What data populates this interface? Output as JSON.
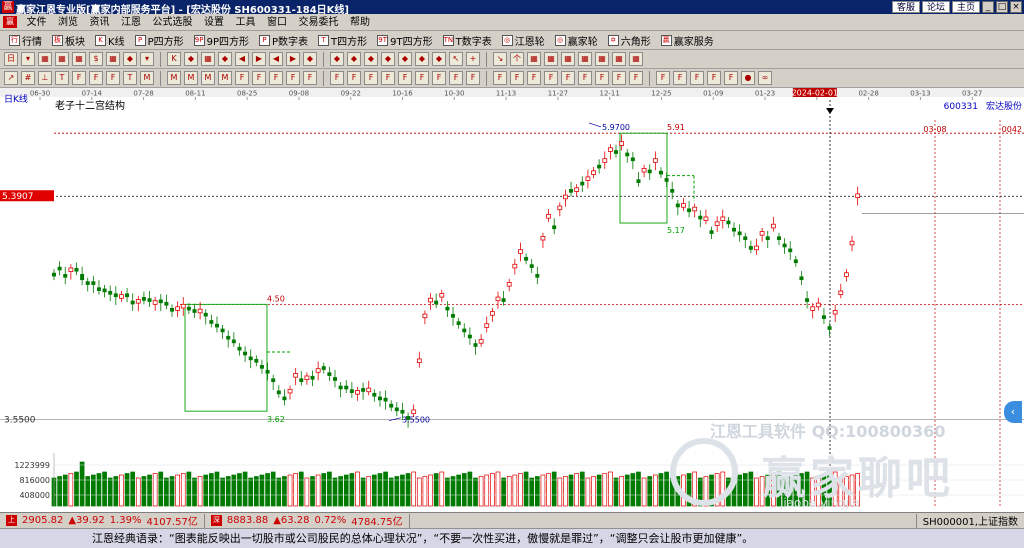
{
  "titlebar": {
    "app_icon": "赢",
    "title": "赢家江恩专业版[赢家内部服务平台] - [宏达股份  SH600331-184日K线]",
    "links": [
      "客服",
      "论坛",
      "主页"
    ],
    "win_buttons": [
      "_",
      "□",
      "×"
    ]
  },
  "menubar": {
    "logo": "赢",
    "items": [
      "文件",
      "浏览",
      "资讯",
      "江恩",
      "公式选股",
      "设置",
      "工具",
      "窗口",
      "交易委托",
      "帮助"
    ]
  },
  "toolbar1": [
    {
      "icon": "行",
      "label": "行情"
    },
    {
      "icon": "板",
      "label": "板块"
    },
    {
      "icon": "K",
      "label": "K线"
    },
    {
      "icon": "P",
      "label": "P四方形"
    },
    {
      "icon": "9P",
      "label": "9P四方形"
    },
    {
      "icon": "P",
      "label": "P数字表"
    },
    {
      "icon": "T",
      "label": "T四方形"
    },
    {
      "icon": "9T",
      "label": "9T四方形"
    },
    {
      "icon": "TN",
      "label": "T数字表"
    },
    {
      "icon": "◎",
      "label": "江恩轮"
    },
    {
      "icon": "◎",
      "label": "赢家轮"
    },
    {
      "icon": "✡",
      "label": "六角形"
    },
    {
      "icon": "赢",
      "label": "赢家服务"
    }
  ],
  "toolbar2_icons": [
    "日",
    "▾",
    "▦",
    "▦",
    "▦",
    "$",
    "▦",
    "◆",
    "▾",
    "K",
    "◆",
    "▦",
    "◆",
    "◀",
    "▶",
    "◀",
    "▶",
    "◆",
    "◆",
    "◆",
    "◆",
    "◆",
    "◆",
    "◆",
    "◆",
    "↖",
    "+",
    "↘",
    "个",
    "▦",
    "▦",
    "▦",
    "▦",
    "▦",
    "▦",
    "▦"
  ],
  "toolbar3_icons": [
    "↗",
    "#",
    "⊥",
    "T",
    "F",
    "F",
    "F",
    "T",
    "M",
    "M",
    "M",
    "M",
    "M",
    "F",
    "F",
    "F",
    "F",
    "F",
    "F",
    "F",
    "F",
    "F",
    "F",
    "F",
    "F",
    "F",
    "F",
    "F",
    "F",
    "F",
    "F",
    "F",
    "F",
    "F",
    "F",
    "F",
    "F",
    "F",
    "F",
    "F",
    "F",
    "●",
    "∞"
  ],
  "chart": {
    "period_label": "日K线",
    "indicator_label": "老子十二宫结构",
    "code": "600331",
    "name": "宏达股份",
    "date_axis": [
      "06-30",
      "07-14",
      "07-28",
      "08-11",
      "08-25",
      "09-08",
      "09-22",
      "10-16",
      "10-30",
      "11-13",
      "11-27",
      "12-11",
      "12-25",
      "01-09",
      "01-23",
      "2024-02-01",
      "02-28",
      "03-13",
      "03-27"
    ],
    "cursor_price": "5.3907",
    "price_axis_bottom": "3.5500",
    "volume_labels": [
      "1223999",
      "816000",
      "408000"
    ],
    "annotations": {
      "high_value": "5.9700",
      "low_value": "3.5500",
      "level_591": "5.91",
      "level_450": "4.50",
      "level_362": "3.62",
      "level_517": "5.17",
      "future_date": "03-08",
      "right_marker": "0042"
    }
  },
  "watermark": {
    "line1": "江恩工具软件  QQ:100800360",
    "big": "赢家聊吧",
    "sub": "jiaoba.yingjia"
  },
  "statusbar": {
    "sh": {
      "icon": "上",
      "price": "2905.82",
      "change": "▲39.92",
      "pct": "1.39%",
      "amount": "4107.57亿"
    },
    "sz": {
      "icon": "深",
      "price": "8883.88",
      "change": "▲63.28",
      "pct": "0.72%",
      "amount": "4784.75亿"
    },
    "index": "SH000001,上证指数"
  },
  "quote_bar": "江恩经典语录：“图表能反映出一切股市或公司股民的总体心理状况”，“不要一次性买进，傲慢就是罪过”，“调整只会让股市更加健康”。",
  "colors": {
    "up": "#e00000",
    "down": "#007a00",
    "grid": "#c8c8c8",
    "level": "#c00000",
    "box": "#00a000",
    "titlebar": "#0a246a"
  },
  "chart_data": {
    "type": "candlestick",
    "title": "",
    "x_type": "trading day index",
    "x_ticks": [
      "06-30",
      "07-14",
      "07-28",
      "08-11",
      "08-25",
      "09-08",
      "09-22",
      "10-16",
      "10-30",
      "11-13",
      "11-27",
      "12-11",
      "12-25",
      "01-09",
      "01-23",
      "2024-02-01"
    ],
    "ylim": [
      3.3,
      6.2
    ],
    "levels": [
      5.91,
      5.97,
      5.3907,
      4.5,
      3.62,
      3.55,
      5.17
    ],
    "closes": [
      4.73,
      4.78,
      4.72,
      4.8,
      4.77,
      4.7,
      4.66,
      4.66,
      4.61,
      4.6,
      4.58,
      4.56,
      4.58,
      4.56,
      4.5,
      4.54,
      4.53,
      4.52,
      4.53,
      4.51,
      4.49,
      4.44,
      4.48,
      4.5,
      4.45,
      4.43,
      4.46,
      4.4,
      4.34,
      4.31,
      4.27,
      4.21,
      4.18,
      4.12,
      4.08,
      4.04,
      4.02,
      3.97,
      3.93,
      3.86,
      3.76,
      3.71,
      3.8,
      3.93,
      3.86,
      3.91,
      3.88,
      3.97,
      3.96,
      3.91,
      3.87,
      3.8,
      3.8,
      3.77,
      3.79,
      3.78,
      3.81,
      3.74,
      3.71,
      3.7,
      3.65,
      3.62,
      3.6,
      3.55,
      3.63,
      4.05,
      4.42,
      4.55,
      4.5,
      4.59,
      4.45,
      4.39,
      4.33,
      4.27,
      4.22,
      4.15,
      4.21,
      4.34,
      4.44,
      4.56,
      4.52,
      4.68,
      4.83,
      4.95,
      4.86,
      4.8,
      4.72,
      5.06,
      5.24,
      5.12,
      5.31,
      5.4,
      5.42,
      5.46,
      5.48,
      5.55,
      5.6,
      5.62,
      5.7,
      5.79,
      5.74,
      5.84,
      5.72,
      5.68,
      5.5,
      5.62,
      5.58,
      5.7,
      5.57,
      5.51,
      5.42,
      5.3,
      5.33,
      5.26,
      5.3,
      5.2,
      5.22,
      5.08,
      5.18,
      5.22,
      5.16,
      5.1,
      5.07,
      5.03,
      4.95,
      4.98,
      5.1,
      5.03,
      5.16,
      5.03,
      4.97,
      4.93,
      4.84,
      4.7,
      4.52,
      4.48,
      4.51,
      4.38,
      4.29,
      4.45,
      4.61,
      4.76,
      5.02,
      5.41
    ],
    "opens": [
      4.76,
      4.81,
      4.75,
      4.77,
      4.8,
      4.75,
      4.69,
      4.69,
      4.64,
      4.63,
      4.61,
      4.59,
      4.55,
      4.59,
      4.53,
      4.51,
      4.56,
      4.55,
      4.5,
      4.54,
      4.52,
      4.47,
      4.45,
      4.47,
      4.48,
      4.46,
      4.43,
      4.43,
      4.37,
      4.34,
      4.3,
      4.24,
      4.21,
      4.15,
      4.11,
      4.07,
      4.05,
      4,
      3.96,
      3.89,
      3.79,
      3.74,
      3.77,
      3.9,
      3.89,
      3.88,
      3.91,
      3.94,
      3.99,
      3.94,
      3.9,
      3.83,
      3.83,
      3.8,
      3.76,
      3.81,
      3.78,
      3.77,
      3.74,
      3.73,
      3.68,
      3.65,
      3.63,
      3.58,
      3.6,
      4.02,
      4.39,
      4.52,
      4.53,
      4.56,
      4.48,
      4.42,
      4.36,
      4.3,
      4.25,
      4.18,
      4.18,
      4.31,
      4.41,
      4.53,
      4.55,
      4.65,
      4.8,
      4.92,
      4.89,
      4.83,
      4.75,
      5.03,
      5.21,
      5.15,
      5.28,
      5.37,
      5.45,
      5.43,
      5.51,
      5.52,
      5.57,
      5.65,
      5.67,
      5.76,
      5.77,
      5.81,
      5.75,
      5.71,
      5.53,
      5.59,
      5.61,
      5.67,
      5.6,
      5.54,
      5.45,
      5.33,
      5.3,
      5.29,
      5.27,
      5.23,
      5.19,
      5.11,
      5.15,
      5.19,
      5.19,
      5.13,
      5.1,
      5.06,
      4.98,
      4.95,
      5.07,
      5.06,
      5.13,
      5.06,
      5,
      4.96,
      4.87,
      4.73,
      4.55,
      4.45,
      4.48,
      4.41,
      4.32,
      4.42,
      4.58,
      4.73,
      4.99,
      5.38
    ]
  }
}
